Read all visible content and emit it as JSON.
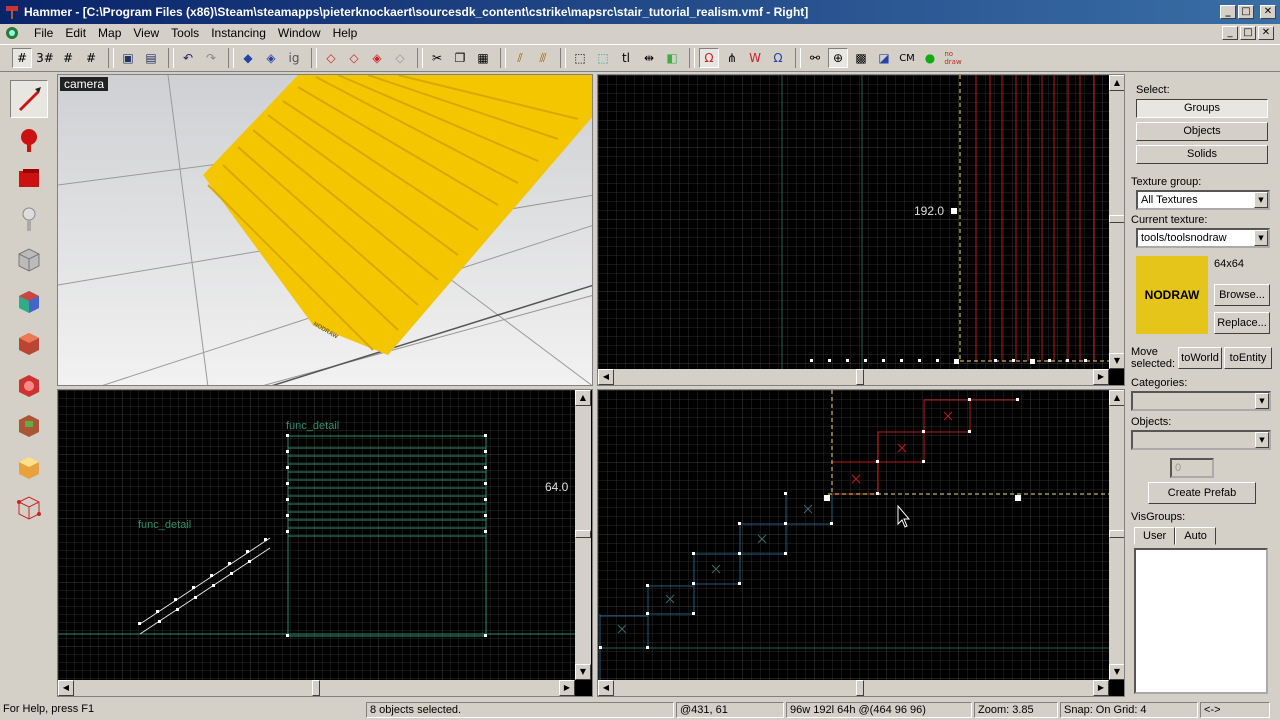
{
  "window": {
    "title": "Hammer - [C:\\Program Files (x86)\\Steam\\steamapps\\pieterknockaert\\sourcesdk_content\\cstrike\\mapsrc\\stair_tutorial_realism.vmf - Right]",
    "controls": {
      "minimize": "_",
      "maximize": "□",
      "close": "✕"
    }
  },
  "menu": [
    "File",
    "Edit",
    "Map",
    "View",
    "Tools",
    "Instancing",
    "Window",
    "Help"
  ],
  "viewports": {
    "camera": {
      "label": "camera",
      "texture_text": "NODRAW"
    },
    "top_right": {
      "coord_label": "192.0"
    },
    "bottom_left": {
      "entity_label_1": "func_detail",
      "entity_label_2": "func_detail",
      "coord_label": "64.0"
    },
    "bottom_right": {}
  },
  "right_panel": {
    "select_label": "Select:",
    "select_buttons": [
      "Groups",
      "Objects",
      "Solids"
    ],
    "texture_group_label": "Texture group:",
    "texture_group_value": "All Textures",
    "current_texture_label": "Current texture:",
    "current_texture_value": "tools/toolsnodraw",
    "texture_size": "64x64",
    "texture_preview_text": "NODRAW",
    "browse_button": "Browse...",
    "replace_button": "Replace...",
    "move_selected_label": "Move selected:",
    "to_world_button": "toWorld",
    "to_entity_button": "toEntity",
    "categories_label": "Categories:",
    "objects_label": "Objects:",
    "objects_count": "0",
    "create_prefab_button": "Create Prefab",
    "visgroups_label": "VisGroups:",
    "visgroup_tabs": [
      "User",
      "Auto"
    ]
  },
  "status": {
    "help": "For Help, press F1",
    "selection": "8 objects selected.",
    "cursor": "@431, 61",
    "size": "96w 192l 64h @(464 96 96)",
    "zoom": "Zoom: 3.85",
    "snap": "Snap: On Grid: 4",
    "extra": "<->"
  },
  "colors": {
    "chrome": "#d4d0c8",
    "title_bar": "#0a246a",
    "grid_line": "#2a2a2a",
    "grid_major": "#404040",
    "selection": "#ff2020",
    "brush_outline": "#2e8f6e",
    "camera_texture": "#e5c51a"
  },
  "toolbar_icons": [
    "grid-toggle",
    "3d-grid",
    "grid-smaller",
    "grid-larger",
    "group",
    "ungroup",
    "undo",
    "redo",
    "carve",
    "hollow",
    "texture-lock",
    "cut",
    "copy",
    "paste",
    "entity-report",
    "check-problems",
    "texture-app",
    "compile",
    "run-map"
  ]
}
